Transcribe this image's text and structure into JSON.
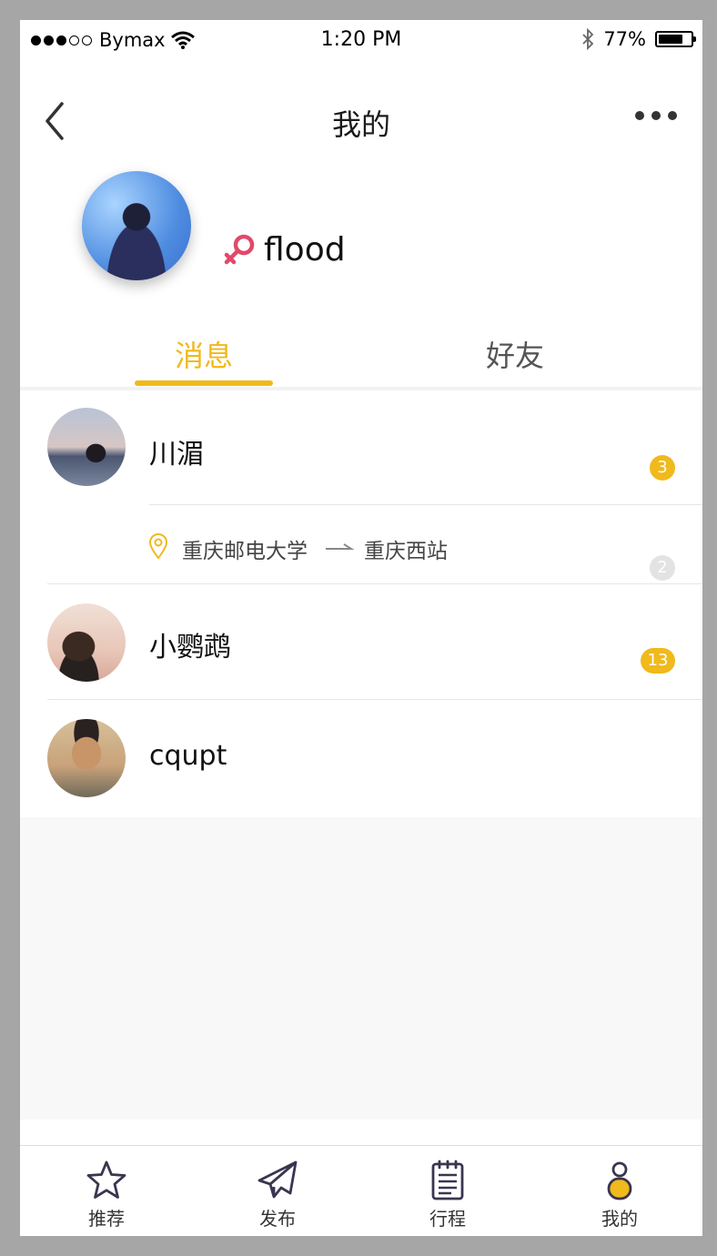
{
  "status_bar": {
    "carrier": "Bymax",
    "signal": {
      "filled": 3,
      "total": 5
    },
    "time": "1:20 PM",
    "battery_percent": "77%",
    "battery_level": 0.77
  },
  "navbar": {
    "title": "我的",
    "back_icon": "chevron-left-icon",
    "more_icon": "more-dots-icon"
  },
  "profile": {
    "username": "flood",
    "gender_icon": "female-symbol-icon"
  },
  "tabs": [
    {
      "label": "消息",
      "active": true
    },
    {
      "label": "好友",
      "active": false
    }
  ],
  "messages": [
    {
      "name": "川湄",
      "unread": "3",
      "route": {
        "from": "重庆邮电大学",
        "to": "重庆西站",
        "count": "2"
      }
    },
    {
      "name": "小鹦鹉",
      "unread": "13"
    },
    {
      "name": "cqupt"
    }
  ],
  "tabbar": [
    {
      "label": "推荐",
      "icon": "star-icon"
    },
    {
      "label": "发布",
      "icon": "paper-plane-icon"
    },
    {
      "label": "行程",
      "icon": "notepad-icon"
    },
    {
      "label": "我的",
      "icon": "profile-icon"
    }
  ],
  "colors": {
    "accent": "#f0b91c",
    "gender": "#e04a6a",
    "badge_grey": "#e3e3e3"
  }
}
